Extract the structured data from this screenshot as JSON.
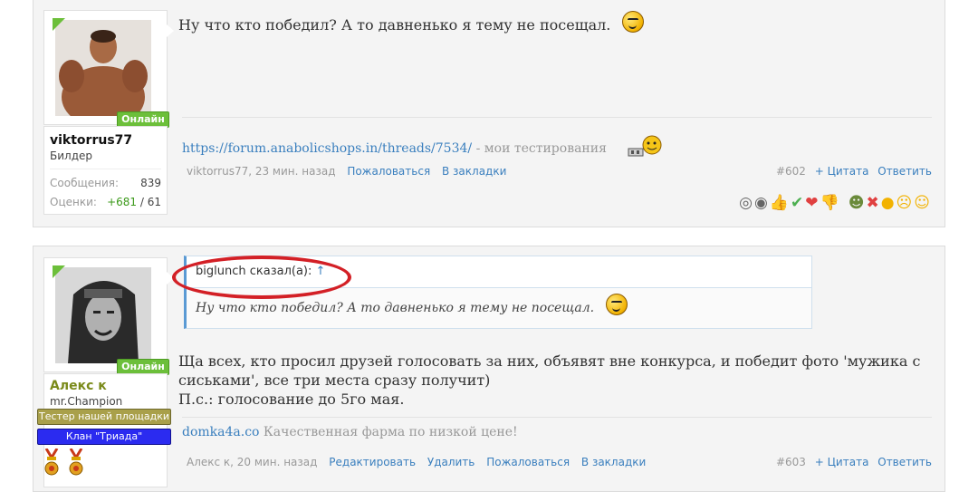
{
  "post1": {
    "username": "viktorrus77",
    "user_title": "Билдер",
    "online_label": "Онлайн",
    "stats": {
      "messages_label": "Сообщения:",
      "messages_value": "839",
      "ratings_label": "Оценки:",
      "ratings_positive": "+681",
      "ratings_rest": " / 61"
    },
    "message": "Ну что кто победил? А то давненько я тему не посещал.",
    "signature": {
      "link": "https://forum.anabolicshops.in/threads/7534/",
      "text": " - мои тестирования"
    },
    "meta": {
      "author_time": "viktorrus77, 23 мин. назад",
      "report": "Пожаловаться",
      "bookmark": "В закладки",
      "number": "#602",
      "quote": "+ Цитата",
      "reply": "Ответить"
    }
  },
  "post2": {
    "username": "Алекс к",
    "user_title": "mr.Champion",
    "online_label": "Онлайн",
    "badge_tester": "Тестер нашей площадки",
    "badge_clan": "Клан \"Триада\"",
    "quote": {
      "author": "biglunch сказал(а):",
      "arrow": "↑",
      "text": "Ну что кто победил? А то давненько я тему не посещал."
    },
    "message_lines": [
      "Ща всех, кто просил друзей голосовать за них, объявят вне конкурса, и победит фото 'мужика с",
      "сиськами', все три места сразу получит)",
      "П.с.: голосование до 5го мая."
    ],
    "signature": {
      "link": "domka4a.co",
      "text": " Качественная фарма по низкой цене!"
    },
    "meta": {
      "author_time": "Алекс к, 20 мин. назад",
      "edit": "Редактировать",
      "delete": "Удалить",
      "report": "Пожаловаться",
      "bookmark": "В закладки",
      "number": "#603",
      "quote": "+ Цитата",
      "reply": "Ответить"
    }
  },
  "colors": {
    "online_green": "#6cbf3a",
    "link_blue": "#3a7fbe",
    "highlight_red": "#d32026",
    "badge_olive": "#a9a04a",
    "badge_blue": "#2b2bf0"
  },
  "icons": [
    "smiley-icon",
    "thumbs-up-icon",
    "check-icon",
    "heart-icon",
    "thumbs-down-icon",
    "medal-icon",
    "up-arrow-icon"
  ]
}
